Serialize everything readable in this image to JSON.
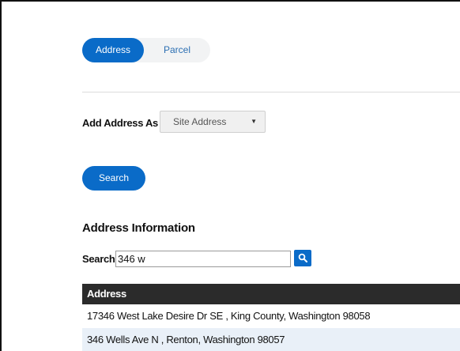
{
  "toggle": {
    "address_label": "Address",
    "parcel_label": "Parcel"
  },
  "add_address": {
    "label": "Add Address As",
    "selected": "Site Address"
  },
  "search_button": {
    "label": "Search"
  },
  "address_info": {
    "title": "Address Information",
    "search_label": "Search",
    "search_value": "346 w"
  },
  "table": {
    "header": "Address",
    "rows": [
      "17346 West Lake Desire Dr SE , King County, Washington 98058",
      "346 Wells Ave N , Renton, Washington 98057"
    ]
  },
  "colors": {
    "accent": "#0a6bc8",
    "header_bg": "#2b2b2b",
    "row_alt": "#e9f0f8"
  }
}
